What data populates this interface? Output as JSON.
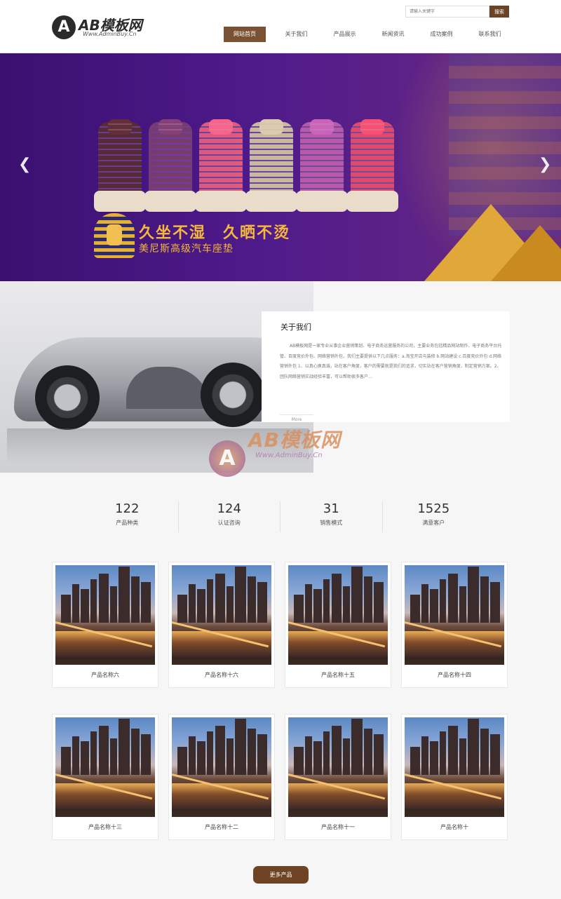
{
  "logo": {
    "mark": "A",
    "title": "AB模板网",
    "subtitle": "Www.AdminBuy.Cn"
  },
  "search": {
    "placeholder": "请输入关键字",
    "button": "搜索"
  },
  "nav": [
    "网站首页",
    "关于我们",
    "产品展示",
    "新闻资讯",
    "成功案例",
    "联系我们"
  ],
  "banner": {
    "slogan": "久坐不湿　久晒不烫",
    "subtitle": "美尼斯高级汽车座垫",
    "prev_icon": "chevron-left-icon",
    "next_icon": "chevron-right-icon",
    "seat_colors": [
      "#5a2a34",
      "#7a3a6e",
      "#e05a7e",
      "#c8b89e",
      "#b85aa8",
      "#e04a6a"
    ]
  },
  "about": {
    "title": "关于我们",
    "text": "AB模板网是一家专业从事企业营销策划、电子商务运营服务的公司，主要业务包括精品网站制作、电子商务平台托管、百度竞价外包、网络营销外包，我们主要提供以下几点服务：a.淘宝开店与装修 b.网站建设 c.百度竞价外包 d.网络营销外包 1、以真心换真诚，站在客户角度，客户的需要就是我们的追求，切实站在客户营销角度，制定营销方案。2、团队网络营销实战经验丰富，可以帮助很多客户…",
    "more": "More"
  },
  "watermark": {
    "mark": "A",
    "title": "AB模板网",
    "subtitle": "Www.AdminBuy.Cn"
  },
  "stats": [
    {
      "value": "122",
      "label": "产品种类"
    },
    {
      "value": "124",
      "label": "认证咨询"
    },
    {
      "value": "31",
      "label": "销售模式"
    },
    {
      "value": "1525",
      "label": "满意客户"
    }
  ],
  "products": [
    "产品名称六",
    "产品名称十六",
    "产品名称十五",
    "产品名称十四",
    "产品名称十三",
    "产品名称十二",
    "产品名称十一",
    "产品名称十"
  ],
  "more_button": "更多产品",
  "colors": {
    "accent": "#7a5233",
    "banner": "#4e1a8a",
    "slogan": "#f5b83a"
  }
}
